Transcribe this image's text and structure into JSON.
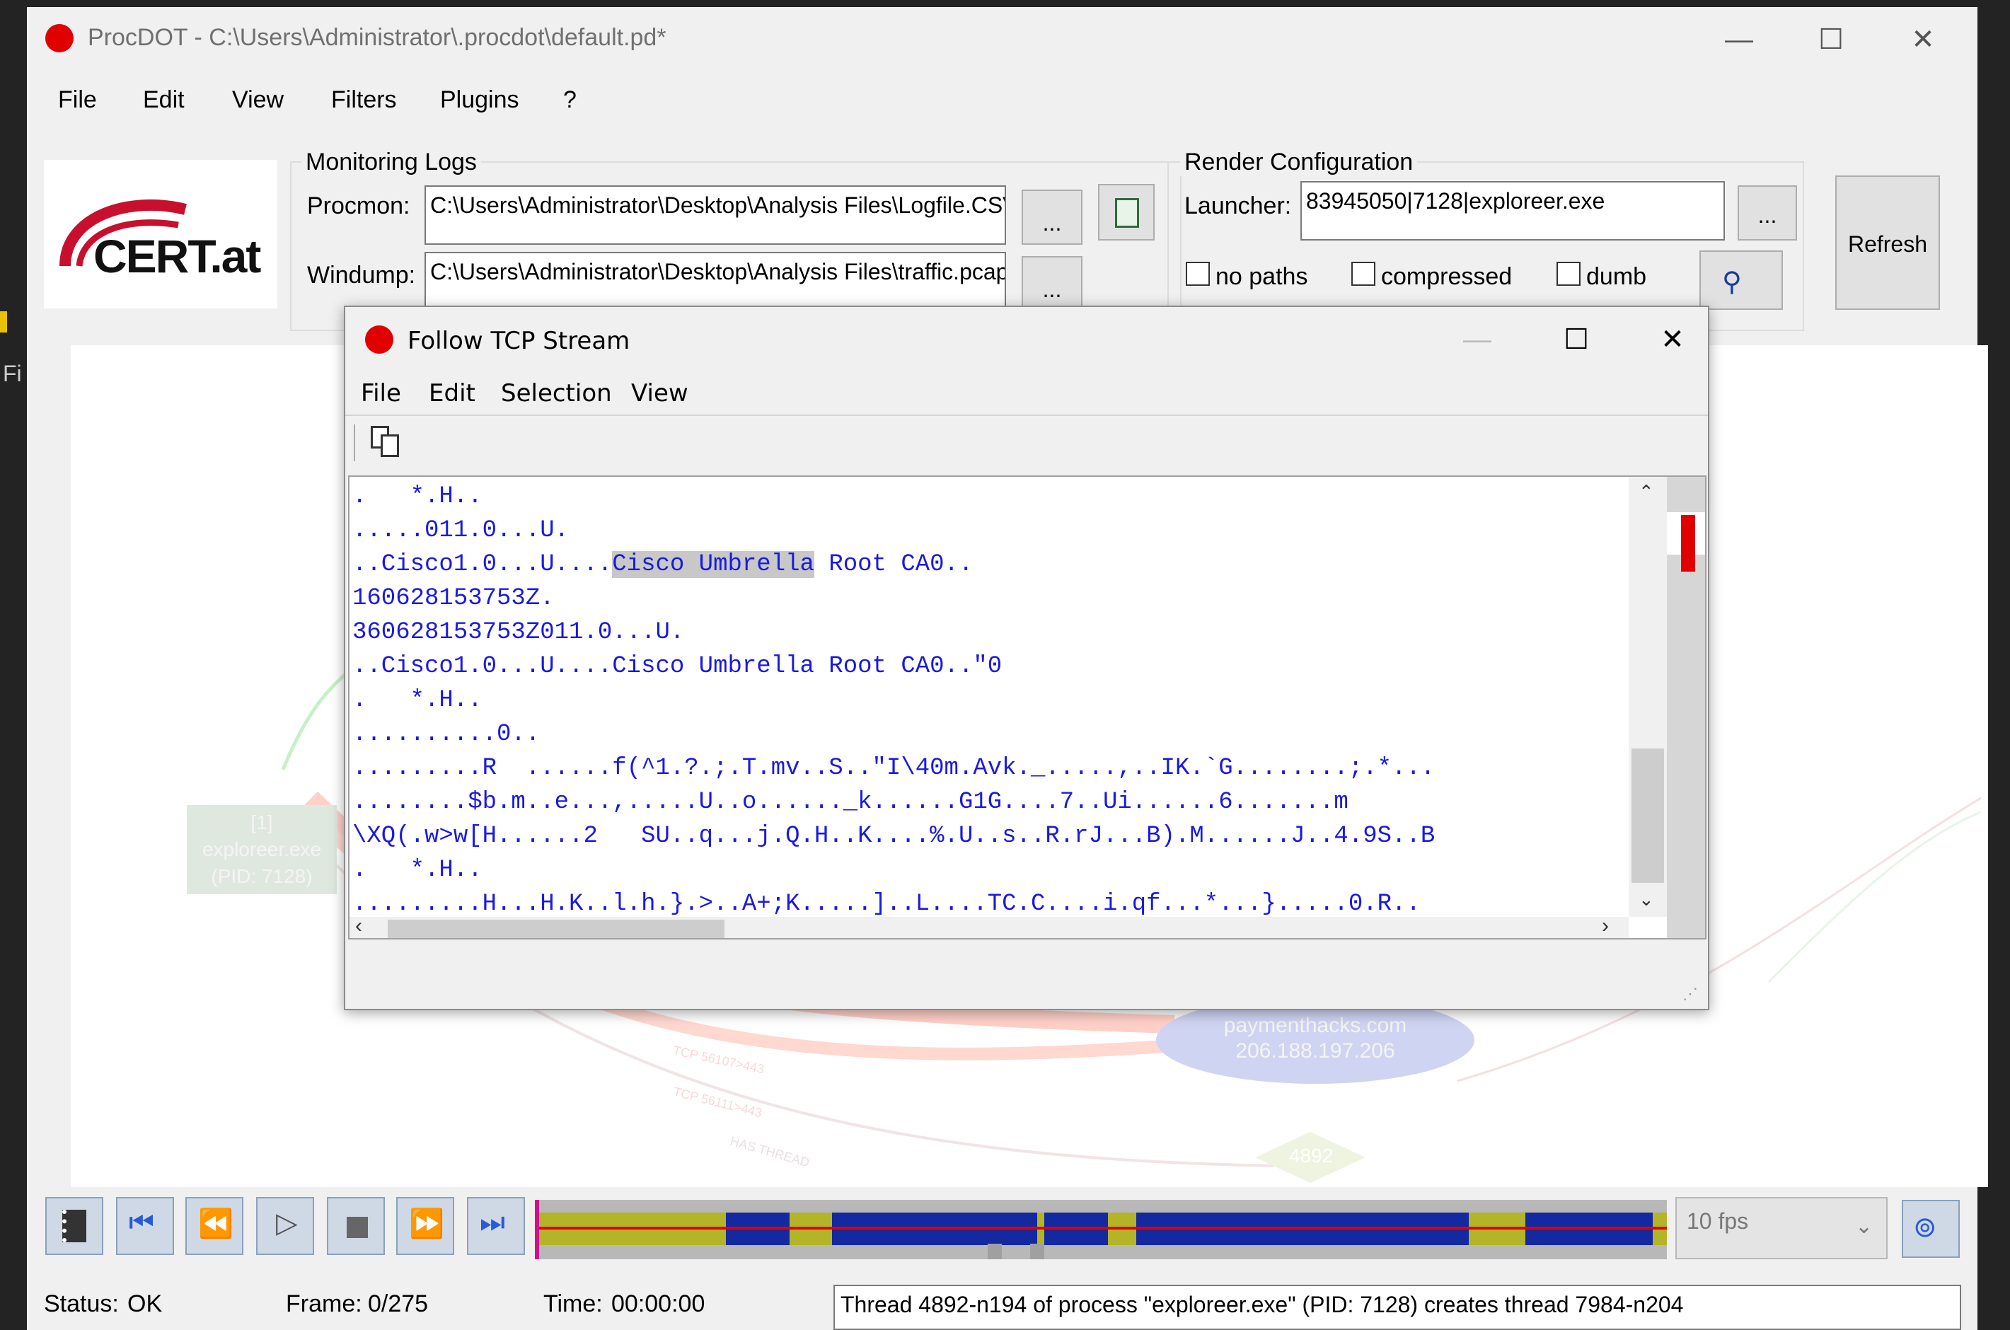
{
  "app": {
    "title": "ProcDOT - C:\\Users\\Administrator\\.procdot\\default.pd*",
    "menu": [
      "File",
      "Edit",
      "View",
      "Filters",
      "Plugins",
      "?"
    ],
    "logo_text": "CERT.at"
  },
  "monitoring": {
    "group_label": "Monitoring Logs",
    "procmon_label": "Procmon:",
    "procmon_value": "C:\\Users\\Administrator\\Desktop\\Analysis Files\\Logfile.CSV",
    "windump_label": "Windump:",
    "windump_value": "C:\\Users\\Administrator\\Desktop\\Analysis Files\\traffic.pcap",
    "browse_label": "..."
  },
  "render": {
    "group_label": "Render Configuration",
    "launcher_label": "Launcher:",
    "launcher_value": "83945050|7128|exploreer.exe",
    "browse_label": "...",
    "options": [
      "no paths",
      "compressed",
      "dumb"
    ],
    "refresh_label": "Refresh"
  },
  "graph": {
    "process_node": [
      "[1]",
      "exploreer.exe",
      "(PID: 7128)"
    ],
    "server_node": [
      "paymenthacks.com",
      "206.188.197.206"
    ],
    "thread_node": "4892",
    "edge_labels": [
      "TCP 56107>443",
      "TCP 56111>443",
      "HAS THREAD"
    ]
  },
  "popup": {
    "title": "Follow TCP Stream",
    "menu": [
      "File",
      "Edit",
      "Selection",
      "View"
    ],
    "copy_icon": "copy-icon",
    "highlight": "Cisco Umbrella",
    "lines": [
      ".   *.H..",
      ".....011.0...U.",
      "..Cisco1.0...U....Cisco Umbrella Root CA0..",
      "160628153753Z.",
      "360628153753Z011.0...U.",
      "..Cisco1.0...U....Cisco Umbrella Root CA0..\"0",
      ".   *.H..",
      "..........0..",
      ".........R  ......f(^1.?.;.T.mv..S..\"I\\40m.Avk._.....,..IK.`G........;.*...",
      "........$b.m..e...,.....U..o......_k......G1G....7..Ui......6.......m",
      "\\XQ(.w>w[H......2   SU..q...j.Q.H..K....%.U..s..R.rJ...B).M......J..4.9S..B",
      ".   *.H..",
      ".........H...H.K..l.h.}.>..A+;K.....]..L....TC.C....i.qf...*...}.....0.R.."
    ]
  },
  "player": {
    "fps_value": "10 fps"
  },
  "status": {
    "status_label": "Status:",
    "status_value": "OK",
    "frame_label": "Frame:",
    "frame_value": "0/275",
    "time_label": "Time:",
    "time_value": "00:00:00",
    "message": "Thread 4892-n194 of process \"exploreer.exe\" (PID: 7128) creates thread 7984-n204"
  },
  "colors": {
    "accent_red": "#e00000",
    "text_blue": "#1a1ae0",
    "timeline_blue": "#1428a0",
    "timeline_olive": "#b4b428"
  }
}
